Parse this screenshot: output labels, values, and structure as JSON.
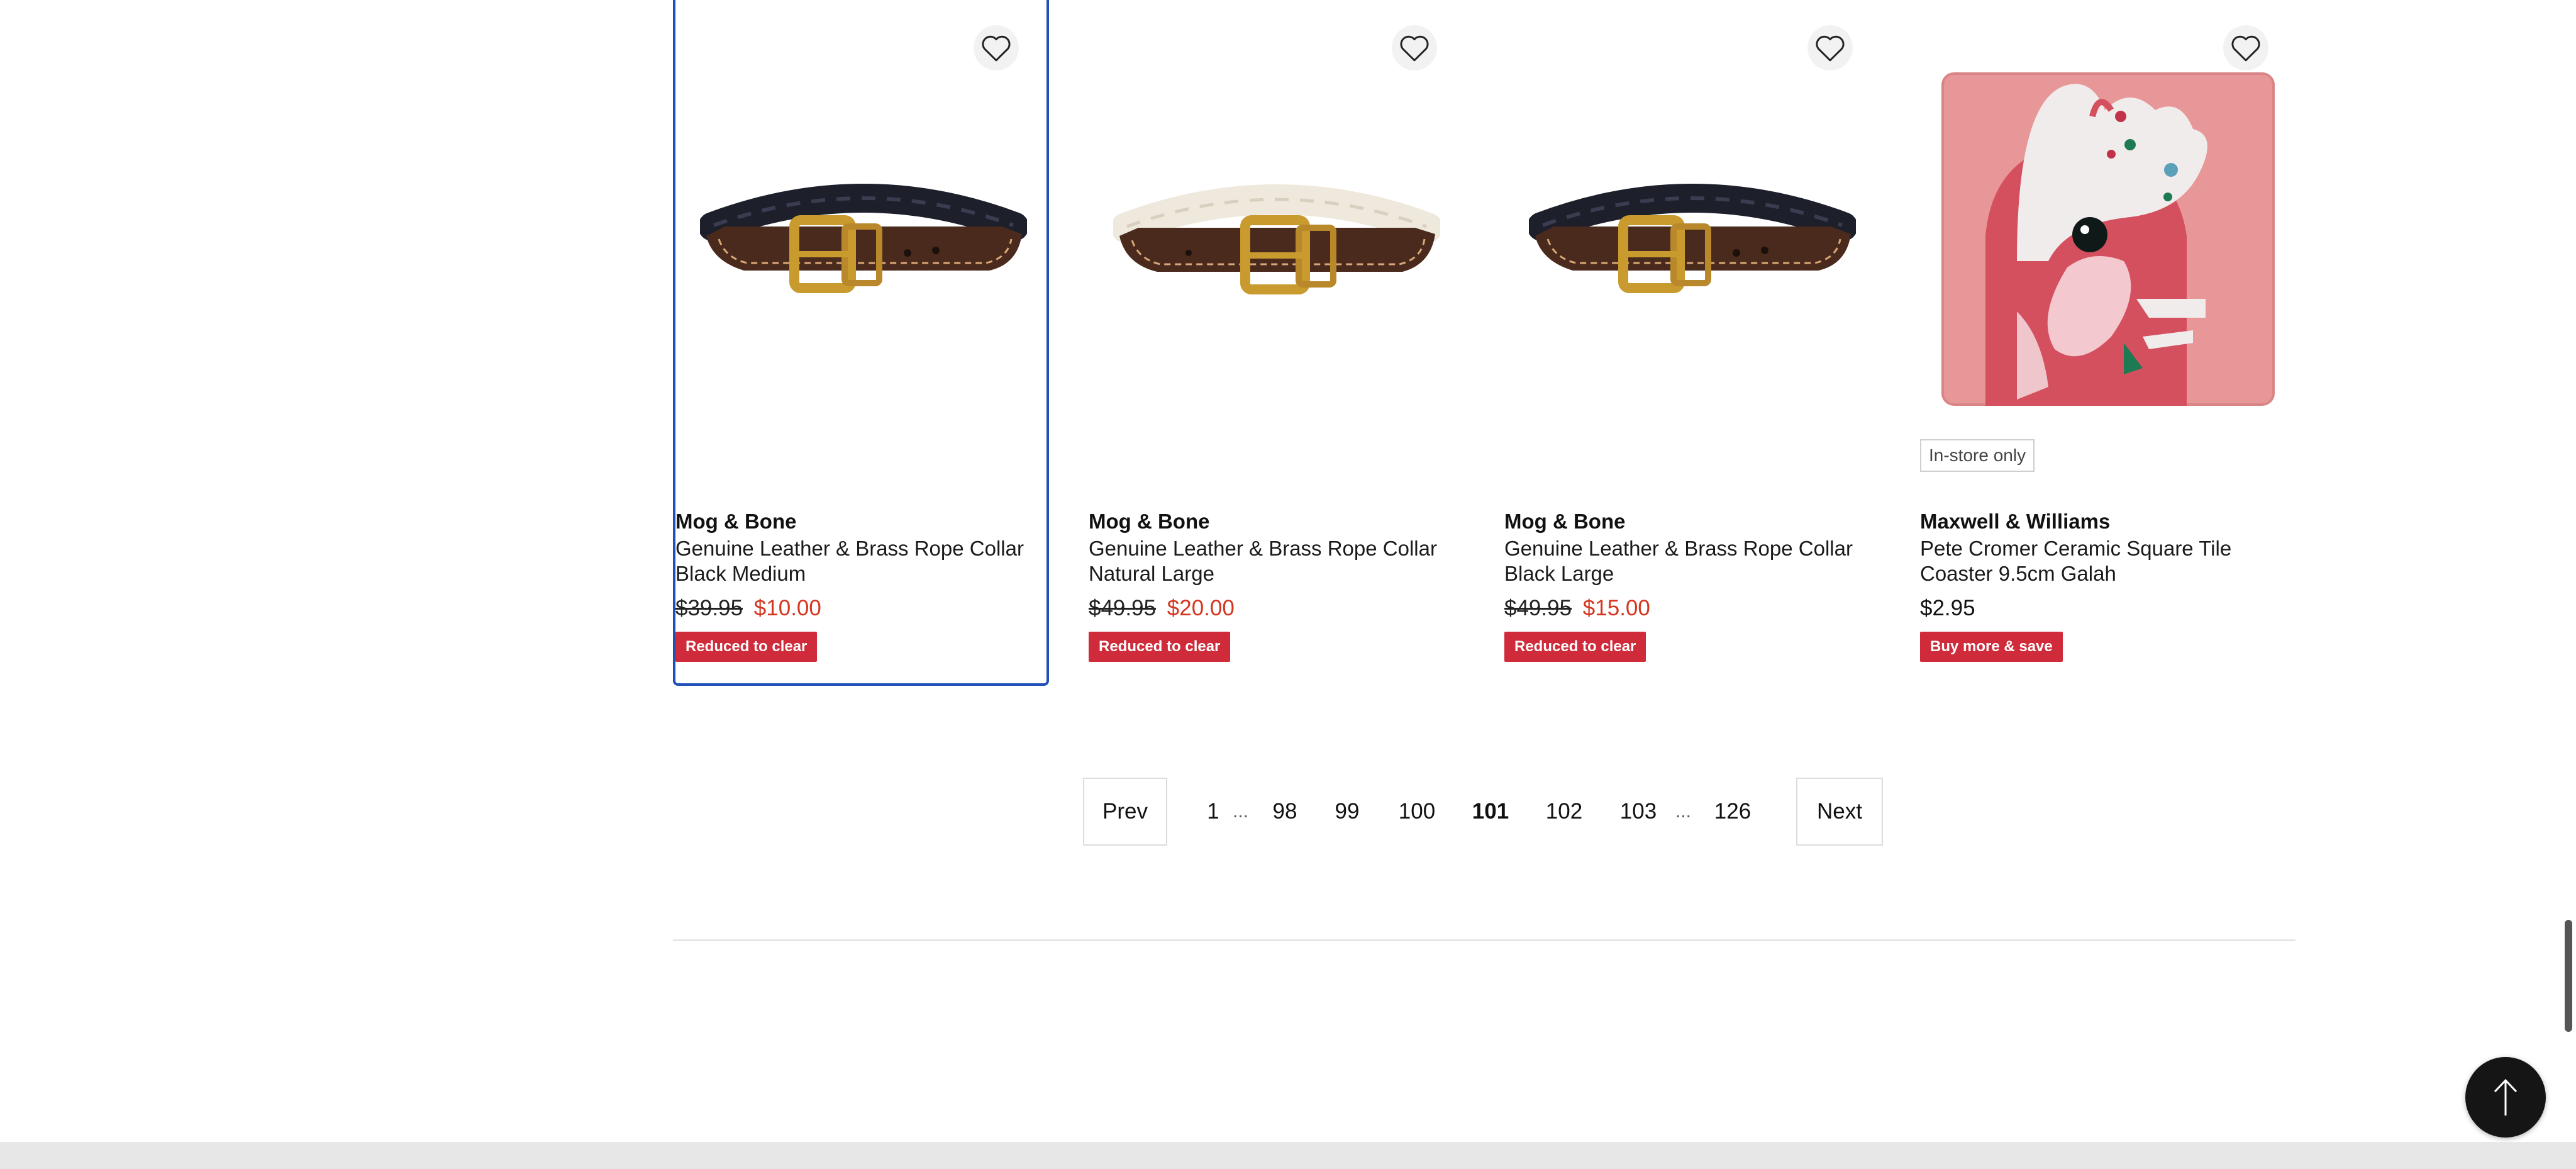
{
  "products": [
    {
      "brand": "Mog & Bone",
      "title": "Genuine Leather & Brass Rope Collar Black Medium",
      "was_price": "$39.95",
      "price": "$10.00",
      "badge": "Reduced to clear",
      "image": "black-rope-collar",
      "focused": true
    },
    {
      "brand": "Mog & Bone",
      "title": "Genuine Leather & Brass Rope Collar Natural Large",
      "was_price": "$49.95",
      "price": "$20.00",
      "badge": "Reduced to clear",
      "image": "natural-rope-collar"
    },
    {
      "brand": "Mog & Bone",
      "title": "Genuine Leather & Brass Rope Collar Black Large",
      "was_price": "$49.95",
      "price": "$15.00",
      "badge": "Reduced to clear",
      "image": "black-rope-collar"
    },
    {
      "brand": "Maxwell & Williams",
      "title": "Pete Cromer Ceramic Square Tile Coaster 9.5cm Galah",
      "tag": "In-store only",
      "price": "$2.95",
      "badge": "Buy more & save",
      "image": "galah-coaster-tile"
    }
  ],
  "pagination": {
    "prev_label": "Prev",
    "next_label": "Next",
    "first": "1",
    "ellipsis": "...",
    "pages": [
      "98",
      "99",
      "100",
      "101",
      "102",
      "103"
    ],
    "current": "101",
    "last": "126"
  },
  "icons": {
    "wishlist": "heart-outline-icon",
    "back_to_top": "arrow-up-icon"
  },
  "colors": {
    "sale_price": "#d4361f",
    "badge_bg": "#cf2b3a",
    "focus_outline": "#1f4fb8",
    "back_to_top_bg": "#151515"
  }
}
